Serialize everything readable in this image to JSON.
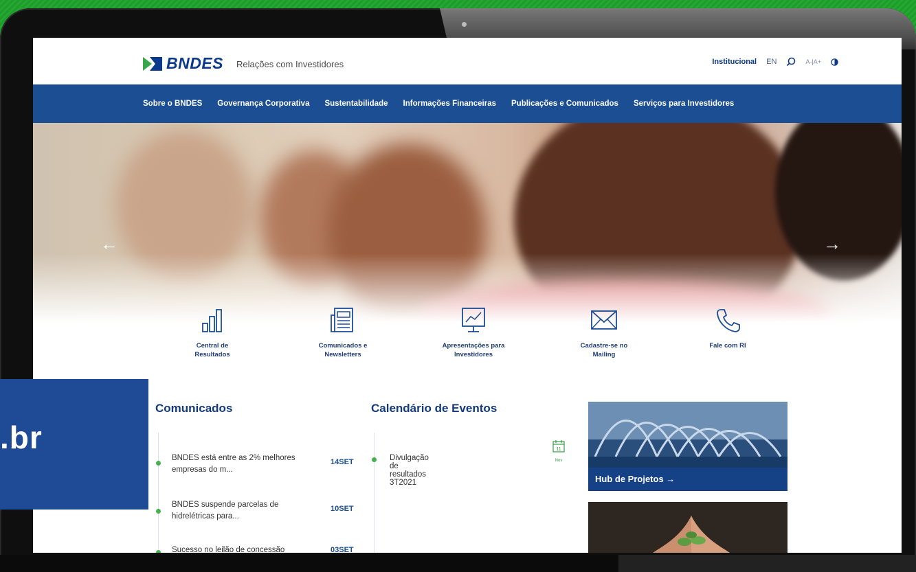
{
  "site": {
    "logo_text": "BNDES",
    "subtitle": "Relações com Investidores"
  },
  "utility": {
    "institutional": "Institucional",
    "language": "EN",
    "font_size": "A-|A+"
  },
  "nav": {
    "items": [
      "Sobre o BNDES",
      "Governança Corporativa",
      "Sustentabilidade",
      "Informações Financeiras",
      "Publicações e Comunicados",
      "Serviços para Investidores"
    ]
  },
  "hero": {
    "prev_arrow": "←",
    "next_arrow": "→"
  },
  "quick_links": [
    {
      "label": "Central de\nResultados",
      "icon": "bar-chart-icon"
    },
    {
      "label": "Comunicados e\nNewsletters",
      "icon": "newspaper-icon"
    },
    {
      "label": "Apresentações para\nInvestidores",
      "icon": "presentation-icon"
    },
    {
      "label": "Cadastre-se no\nMailing",
      "icon": "envelope-icon"
    },
    {
      "label": "Fale com RI",
      "icon": "phone-icon"
    }
  ],
  "comunicados": {
    "title": "Comunicados",
    "items": [
      {
        "text": "BNDES está entre as 2% melhores empresas do m...",
        "date": "14SET"
      },
      {
        "text": "BNDES suspende parcelas de hidrelétricas para...",
        "date": "10SET"
      },
      {
        "text": "Sucesso no leilão de concessão",
        "date": "03SET"
      }
    ]
  },
  "calendario": {
    "title": "Calendário de Eventos",
    "items": [
      {
        "text": "Divulgação de resultados 3T2021",
        "day": "11",
        "month": "Nov"
      }
    ]
  },
  "cards": {
    "hub_label": "Hub de Projetos →"
  },
  "overlay": {
    "text": ".br"
  },
  "colors": {
    "brand_blue": "#1c4e94",
    "accent_green": "#44b24e",
    "background_green": "#1f9a2b"
  }
}
